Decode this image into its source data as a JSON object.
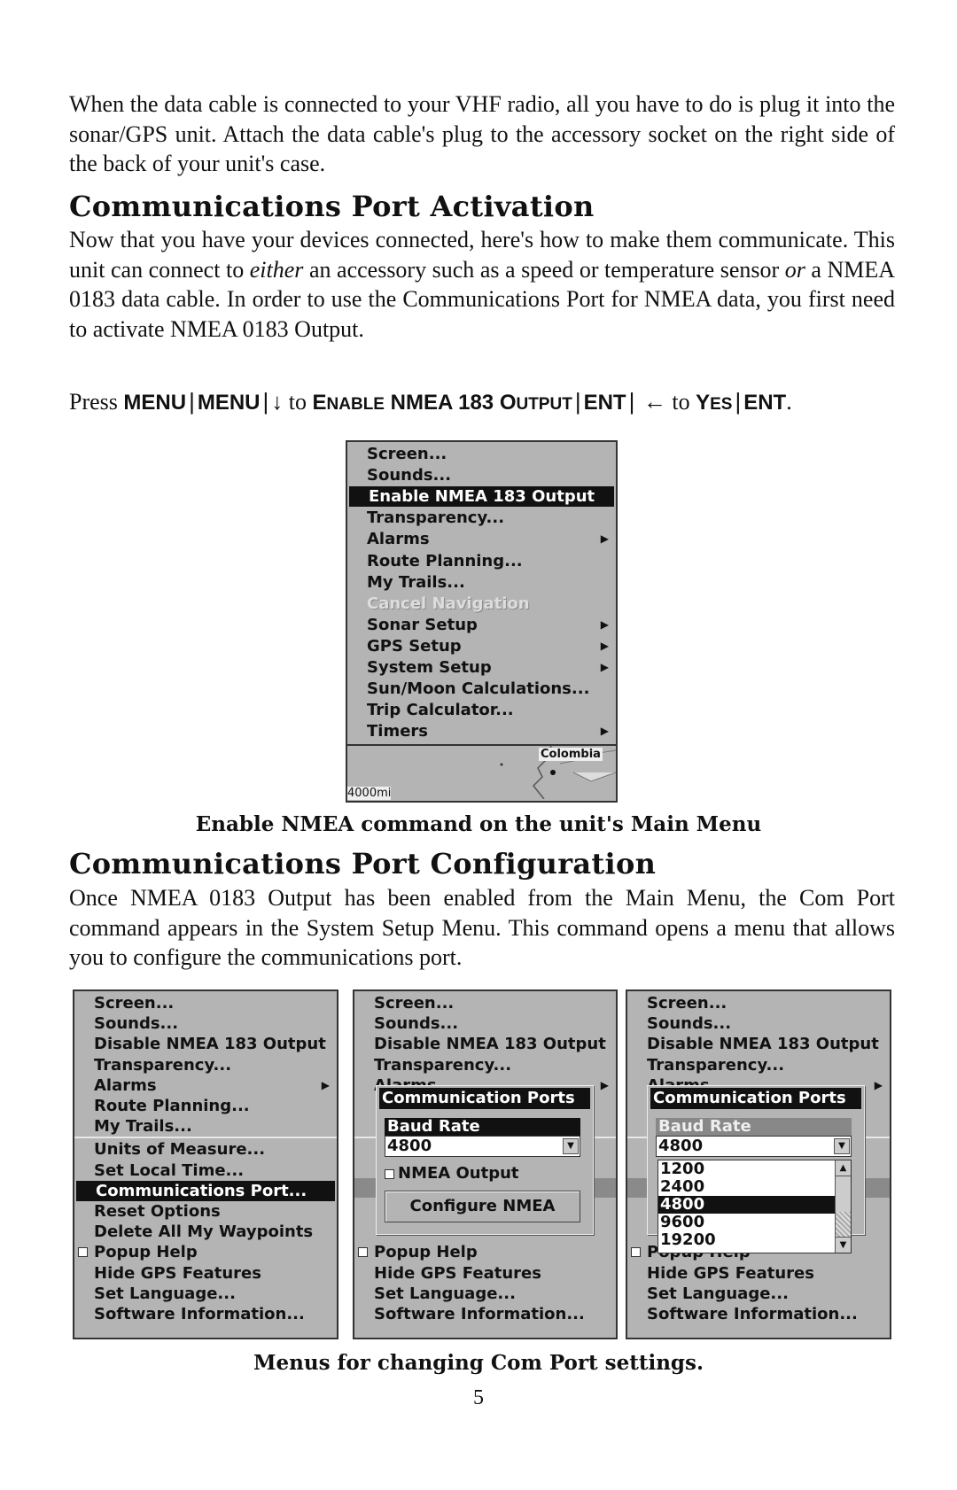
{
  "intro": "When the data cable is connected to your VHF radio, all you have to do is plug it into the sonar/GPS unit. Attach the data cable's plug to the accessory socket on the right side of the back of your unit's case.",
  "section1": {
    "heading": "Communications Port Activation",
    "para_a": "Now that you have your devices connected, here's how to make them communicate. This unit can connect to ",
    "para_em1": "either",
    "para_b": " an accessory such as a speed or temperature sensor ",
    "para_em2": "or",
    "para_c": " a NMEA 0183 data cable. In order to use the Communications Port for NMEA data, you first need to activate NMEA 0183 Output.",
    "press": {
      "word": "Press",
      "k1": "MENU",
      "k2": "MENU",
      "down": "↓",
      "to1": "to",
      "cmd_E": "E",
      "cmd_nable": "NABLE",
      "cmd_nmea": "NMEA 183",
      "cmd_O": "O",
      "cmd_utput": "UTPUT",
      "k3": "ENT",
      "left": "←",
      "to2": "to",
      "yes_Y": "Y",
      "yes_es": "ES",
      "k4": "ENT",
      "end": ".",
      "sep": "|"
    },
    "main_menu": {
      "items": [
        {
          "label": "Screen..."
        },
        {
          "label": "Sounds..."
        },
        {
          "label": "Enable NMEA 183 Output",
          "selected": true
        },
        {
          "label": "Transparency..."
        },
        {
          "label": "Alarms",
          "submenu": true
        },
        {
          "label": "Route Planning..."
        },
        {
          "label": "My Trails..."
        },
        {
          "label": "Cancel Navigation",
          "disabled": true
        },
        {
          "label": "Sonar Setup",
          "submenu": true
        },
        {
          "label": "GPS Setup",
          "submenu": true
        },
        {
          "label": "System Setup",
          "submenu": true
        },
        {
          "label": "Sun/Moon Calculations..."
        },
        {
          "label": "Trip Calculator..."
        },
        {
          "label": "Timers",
          "submenu": true
        }
      ],
      "map_label": "Colombia",
      "map_scale": "4000mi"
    },
    "caption": "Enable NMEA command on the unit's Main Menu"
  },
  "section2": {
    "heading": "Communications Port Configuration",
    "para": "Once NMEA 0183 Output has been enabled from the Main Menu, the Com Port command appears in the System Setup Menu. This command opens a menu that allows you to configure the communications port.",
    "system_menu": [
      {
        "label": "Screen..."
      },
      {
        "label": "Sounds..."
      },
      {
        "label": "Disable NMEA 183 Output"
      },
      {
        "label": "Transparency..."
      },
      {
        "label": "Alarms",
        "submenu": true
      },
      {
        "label": "Route Planning..."
      },
      {
        "label": "My Trails..."
      },
      {
        "label": "Units of Measure..."
      },
      {
        "label": "Set Local Time..."
      },
      {
        "label": "Communications Port...",
        "selected": true
      },
      {
        "label": "Reset Options"
      },
      {
        "label": "Delete All My Waypoints"
      },
      {
        "label": "Popup Help",
        "checkbox": true
      },
      {
        "label": "Hide GPS Features"
      },
      {
        "label": "Set Language..."
      },
      {
        "label": "Software Information..."
      }
    ],
    "dialog": {
      "title": "Communication Ports",
      "baud_label": "Baud Rate",
      "baud_value": "4800",
      "nmea_output_label": "NMEA Output",
      "nmea_output_checked": false,
      "configure_button": "Configure NMEA"
    },
    "baud_options": [
      "1200",
      "2400",
      "4800",
      "9600",
      "19200"
    ],
    "baud_selected": "4800",
    "caption": "Menus for changing Com Port settings."
  },
  "page_number": "5"
}
